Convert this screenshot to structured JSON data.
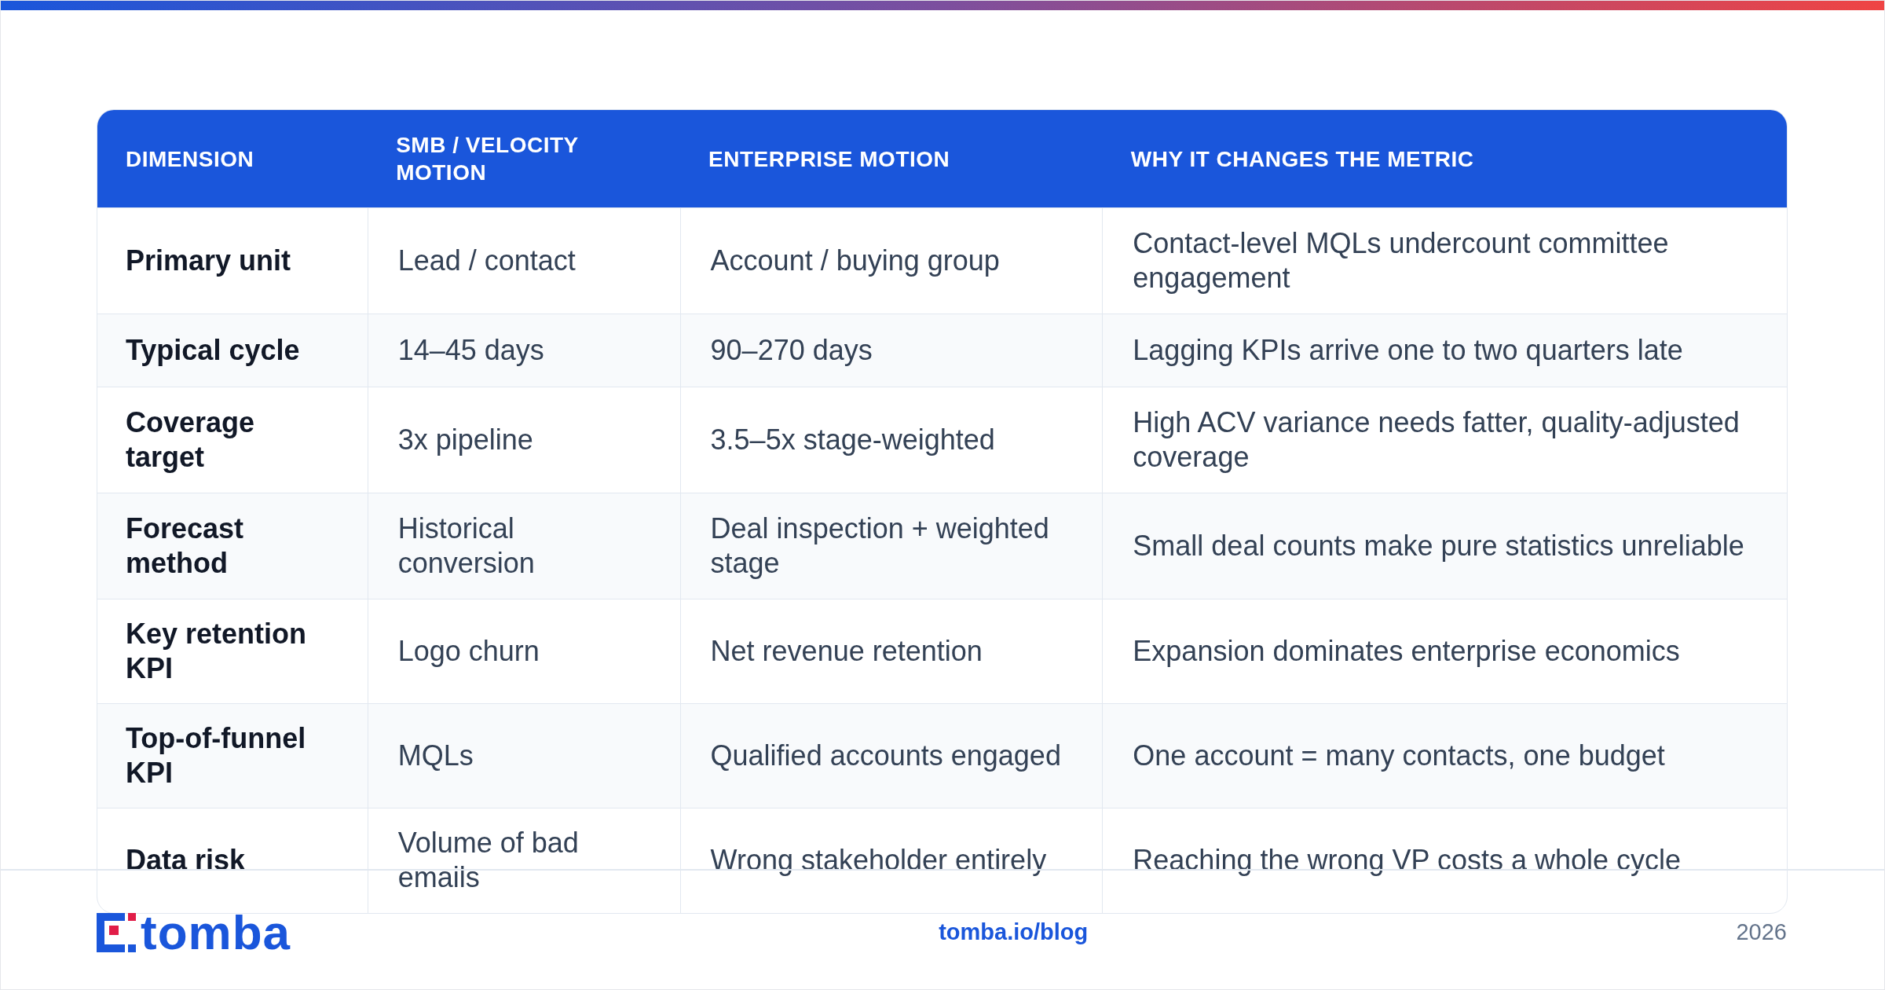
{
  "table": {
    "columns": [
      "DIMENSION",
      "SMB / VELOCITY MOTION",
      "ENTERPRISE MOTION",
      "WHY IT CHANGES THE METRIC"
    ],
    "rows": [
      [
        "Primary unit",
        "Lead / contact",
        "Account / buying group",
        "Contact-level MQLs undercount committee engagement"
      ],
      [
        "Typical cycle",
        "14–45 days",
        "90–270 days",
        "Lagging KPIs arrive one to two quarters late"
      ],
      [
        "Coverage target",
        "3x pipeline",
        "3.5–5x stage-weighted",
        "High ACV variance needs fatter, quality-adjusted coverage"
      ],
      [
        "Forecast method",
        "Historical conversion",
        "Deal inspection + weighted stage",
        "Small deal counts make pure statistics unreliable"
      ],
      [
        "Key retention KPI",
        "Logo churn",
        "Net revenue retention",
        "Expansion dominates enterprise economics"
      ],
      [
        "Top-of-funnel KPI",
        "MQLs",
        "Qualified accounts engaged",
        "One account = many contacts, one budget"
      ],
      [
        "Data risk",
        "Volume of bad emails",
        "Wrong stakeholder entirely",
        "Reaching the wrong VP costs a whole cycle"
      ]
    ]
  },
  "footer": {
    "logo": "tomba",
    "link": "tomba.io/blog",
    "year": "2026"
  }
}
